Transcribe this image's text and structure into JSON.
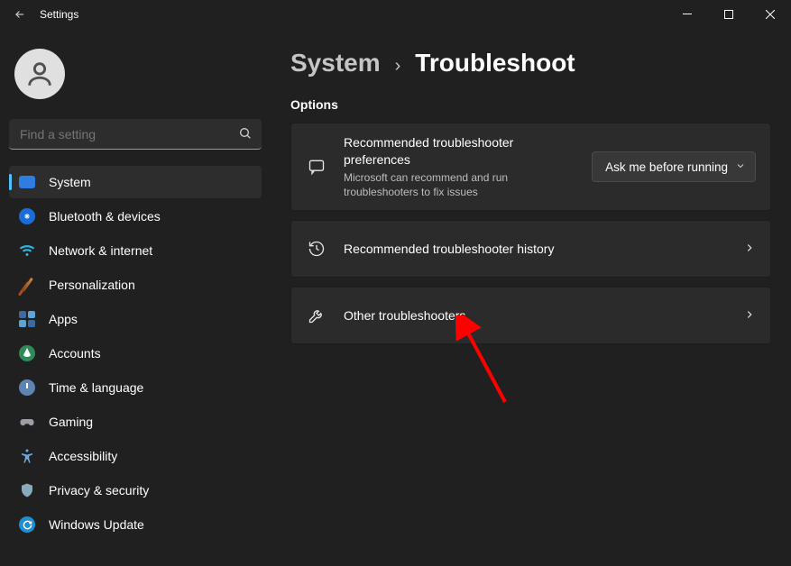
{
  "titlebar": {
    "app_title": "Settings"
  },
  "search": {
    "placeholder": "Find a setting"
  },
  "sidebar": {
    "items": [
      {
        "label": "System"
      },
      {
        "label": "Bluetooth & devices"
      },
      {
        "label": "Network & internet"
      },
      {
        "label": "Personalization"
      },
      {
        "label": "Apps"
      },
      {
        "label": "Accounts"
      },
      {
        "label": "Time & language"
      },
      {
        "label": "Gaming"
      },
      {
        "label": "Accessibility"
      },
      {
        "label": "Privacy & security"
      },
      {
        "label": "Windows Update"
      }
    ]
  },
  "breadcrumb": {
    "parent": "System",
    "separator": "›",
    "current": "Troubleshoot"
  },
  "section_label": "Options",
  "cards": {
    "pref": {
      "title": "Recommended troubleshooter preferences",
      "subtitle": "Microsoft can recommend and run troubleshooters to fix issues",
      "dropdown_value": "Ask me before running"
    },
    "history": {
      "title": "Recommended troubleshooter history"
    },
    "other": {
      "title": "Other troubleshooters"
    }
  }
}
